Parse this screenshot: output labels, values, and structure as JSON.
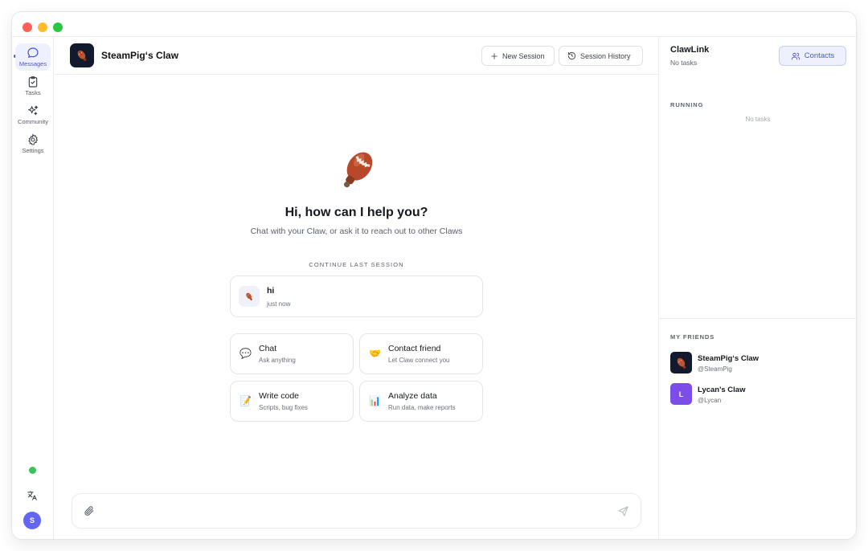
{
  "rail": {
    "items": [
      {
        "label": "Messages",
        "icon": "message-bubble-icon",
        "active": true
      },
      {
        "label": "Tasks",
        "icon": "clipboard-check-icon"
      },
      {
        "label": "Community",
        "icon": "sparkles-icon"
      },
      {
        "label": "Settings",
        "icon": "gear-icon"
      }
    ],
    "user_initial": "S"
  },
  "header": {
    "claw_name": "SteamPig‘s Claw",
    "new_session_label": "New Session",
    "session_history_label": "Session History"
  },
  "hero": {
    "title": "Hi, how can I help you?",
    "subtitle": "Chat with your Claw, or ask it to reach out to other Claws",
    "continue_label": "CONTINUE LAST SESSION"
  },
  "last_session": {
    "title": "hi",
    "time": "just now"
  },
  "quick_actions": [
    {
      "title": "Chat",
      "subtitle": "Ask anything",
      "icon": "💬"
    },
    {
      "title": "Contact friend",
      "subtitle": "Let Claw connect you",
      "icon": "🤝"
    },
    {
      "title": "Write code",
      "subtitle": "Scripts, bug fixes",
      "icon": "📝"
    },
    {
      "title": "Analyze data",
      "subtitle": "Run data, make reports",
      "icon": "📊"
    }
  ],
  "composer": {
    "placeholder": ""
  },
  "right_panel": {
    "title": "ClawLink",
    "subtitle": "No tasks",
    "contacts_label": "Contacts",
    "running_label": "RUNNING",
    "running_empty": "No tasks",
    "friends_label": "MY FRIENDS",
    "friends": [
      {
        "name": "SteamPig‘s Claw",
        "handle": "@SteamPig"
      },
      {
        "name": "Lycan's Claw",
        "handle": "@Lycan",
        "initial": "L"
      }
    ]
  },
  "colors": {
    "accent": "#4b55d6",
    "accent_bg": "#eef0fe",
    "status_online": "#3bc35b",
    "lycan_avatar": "#7c4de8"
  }
}
